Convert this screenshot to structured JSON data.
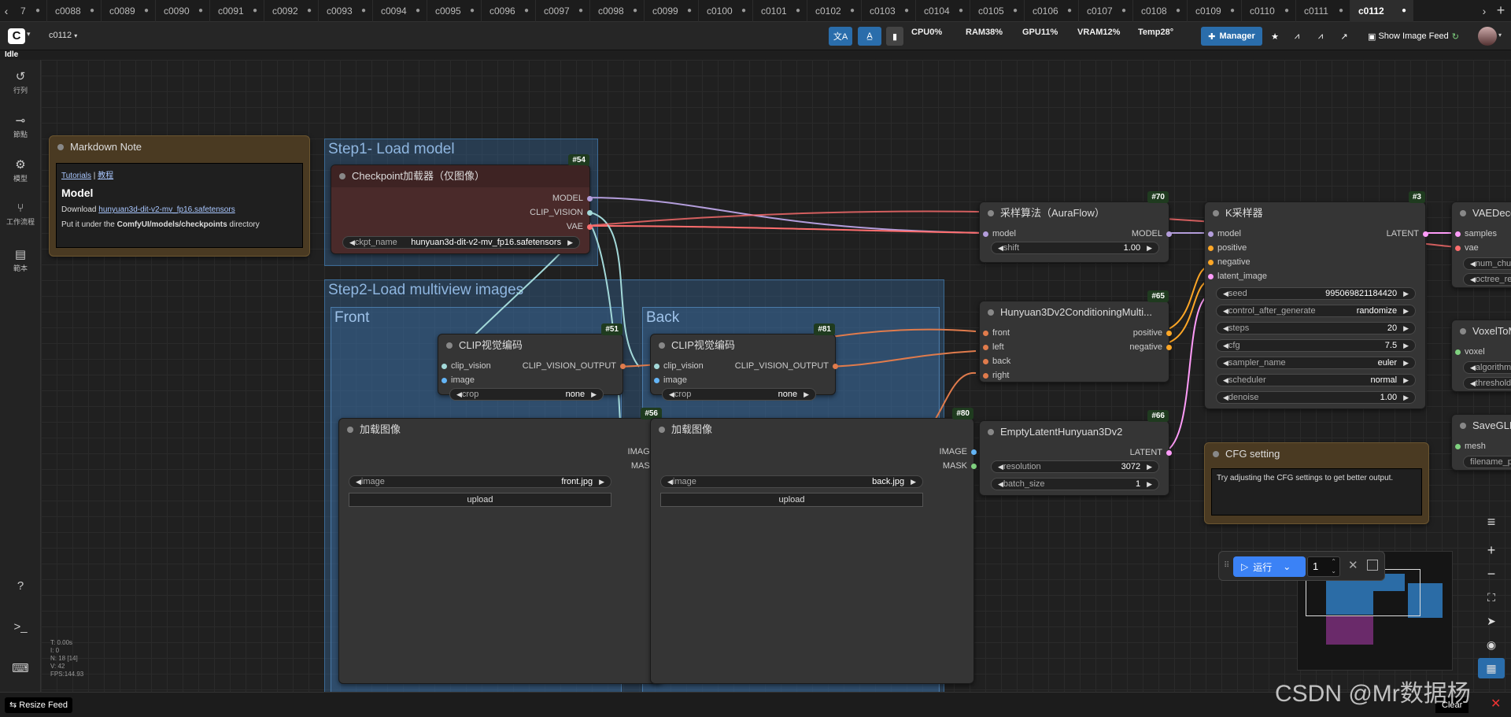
{
  "tabs": {
    "first_partial": "7",
    "items": [
      "c0088",
      "c0089",
      "c0090",
      "c0091",
      "c0092",
      "c0093",
      "c0094",
      "c0095",
      "c0096",
      "c0097",
      "c0098",
      "c0099",
      "c0100",
      "c0101",
      "c0102",
      "c0103",
      "c0104",
      "c0105",
      "c0106",
      "c0107",
      "c0108",
      "c0109",
      "c0110",
      "c0111"
    ],
    "active": "c0112",
    "new_tab": "+"
  },
  "topbar": {
    "workflow_name": "c0112",
    "status": "Idle",
    "cpu": "CPU0%",
    "ram": "RAM38%",
    "gpu": "GPU11%",
    "vram": "VRAM12%",
    "temp": "Temp28°",
    "manager_label": "Manager",
    "show_feed_label": "Show Image Feed"
  },
  "sidebar": [
    {
      "label": "行列",
      "icon": "history-icon"
    },
    {
      "label": "節點",
      "icon": "node-icon"
    },
    {
      "label": "模型",
      "icon": "model-icon"
    },
    {
      "label": "工作流程",
      "icon": "workflow-icon"
    },
    {
      "label": "範本",
      "icon": "template-icon"
    }
  ],
  "groups": {
    "step1": "Step1- Load model",
    "step2": "Step2-Load multiview images",
    "front": "Front",
    "back": "Back"
  },
  "markdown_note": {
    "title": "Markdown Note",
    "link1": "Tutorials",
    "sep": " | ",
    "link2": "教程",
    "heading": "Model",
    "download_prefix": "Download ",
    "download_link": "hunyuan3d-dit-v2-mv_fp16.safetensors",
    "put_prefix": "Put it under the ",
    "put_path": "ComfyUI/models/checkpoints",
    "put_suffix": " directory"
  },
  "nodes": {
    "checkpoint": {
      "id": "#54",
      "title": "Checkpoint加载器（仅图像）",
      "out_model": "MODEL",
      "out_clip": "CLIP_VISION",
      "out_vae": "VAE",
      "w_label": "ckpt_name",
      "w_value": "hunyuan3d-dit-v2-mv_fp16.safetensors"
    },
    "clip1": {
      "id": "#51",
      "title": "CLIP视觉编码",
      "in1": "clip_vision",
      "in2": "image",
      "out": "CLIP_VISION_OUTPUT",
      "w_label": "crop",
      "w_value": "none"
    },
    "clip2": {
      "id": "#81",
      "title": "CLIP视觉编码",
      "in1": "clip_vision",
      "in2": "image",
      "out": "CLIP_VISION_OUTPUT",
      "w_label": "crop",
      "w_value": "none"
    },
    "load1": {
      "id": "#56",
      "title": "加载图像",
      "out1": "IMAGE",
      "out2": "MASK",
      "w_label": "image",
      "w_value": "front.jpg",
      "upload": "upload"
    },
    "load2": {
      "id": "#80",
      "title": "加载图像",
      "out1": "IMAGE",
      "out2": "MASK",
      "w_label": "image",
      "w_value": "back.jpg",
      "upload": "upload"
    },
    "sampling": {
      "id": "#70",
      "title": "采样算法（AuraFlow）",
      "in": "model",
      "out": "MODEL",
      "w_label": "shift",
      "w_value": "1.00"
    },
    "cond": {
      "id": "#65",
      "title": "Hunyuan3Dv2ConditioningMulti...",
      "in1": "front",
      "in2": "left",
      "in3": "back",
      "in4": "right",
      "out1": "positive",
      "out2": "negative"
    },
    "latent": {
      "id": "#66",
      "title": "EmptyLatentHunyuan3Dv2",
      "out": "LATENT",
      "w1_label": "resolution",
      "w1_value": "3072",
      "w2_label": "batch_size",
      "w2_value": "1"
    },
    "ksampler": {
      "id": "#3",
      "title": "K采样器",
      "in1": "model",
      "in2": "positive",
      "in3": "negative",
      "in4": "latent_image",
      "out": "LATENT",
      "widgets": [
        {
          "label": "seed",
          "value": "995069821184420"
        },
        {
          "label": "control_after_generate",
          "value": "randomize"
        },
        {
          "label": "steps",
          "value": "20"
        },
        {
          "label": "cfg",
          "value": "7.5"
        },
        {
          "label": "sampler_name",
          "value": "euler"
        },
        {
          "label": "scheduler",
          "value": "normal"
        },
        {
          "label": "denoise",
          "value": "1.00"
        }
      ]
    },
    "vaedec": {
      "title": "VAEDeco",
      "in1": "samples",
      "in2": "vae",
      "w1": "num_chu",
      "w2": "octree_re"
    },
    "voxel": {
      "title": "VoxelToM",
      "in": "voxel",
      "w1": "algorithm",
      "w2": "threshold"
    },
    "saveglb": {
      "title": "SaveGLB",
      "in": "mesh",
      "w1": "filename_p"
    }
  },
  "cfg_note": {
    "title": "CFG setting",
    "text": "Try adjusting the CFG settings to get better output."
  },
  "runbar": {
    "run_label": "运行",
    "count": "1"
  },
  "stats": {
    "t": "T: 0.00s",
    "i": "I: 0",
    "n": "N: 18 [14]",
    "v": "V: 42",
    "fps": "FPS:144.93"
  },
  "bottom": {
    "resize_feed": "Resize Feed",
    "clear": "Clear"
  },
  "watermark": "CSDN @Mr数据杨",
  "colors": {
    "accent": "#2a6dab",
    "model_wire": "#b39ddb",
    "vae_wire": "#ff6e6e",
    "clip_wire": "#a3d9d9",
    "image_wire": "#64b5f6",
    "cond_wire": "#ffa726",
    "latent_wire": "#ff9cf9",
    "note_brown": "#4a3a22"
  }
}
